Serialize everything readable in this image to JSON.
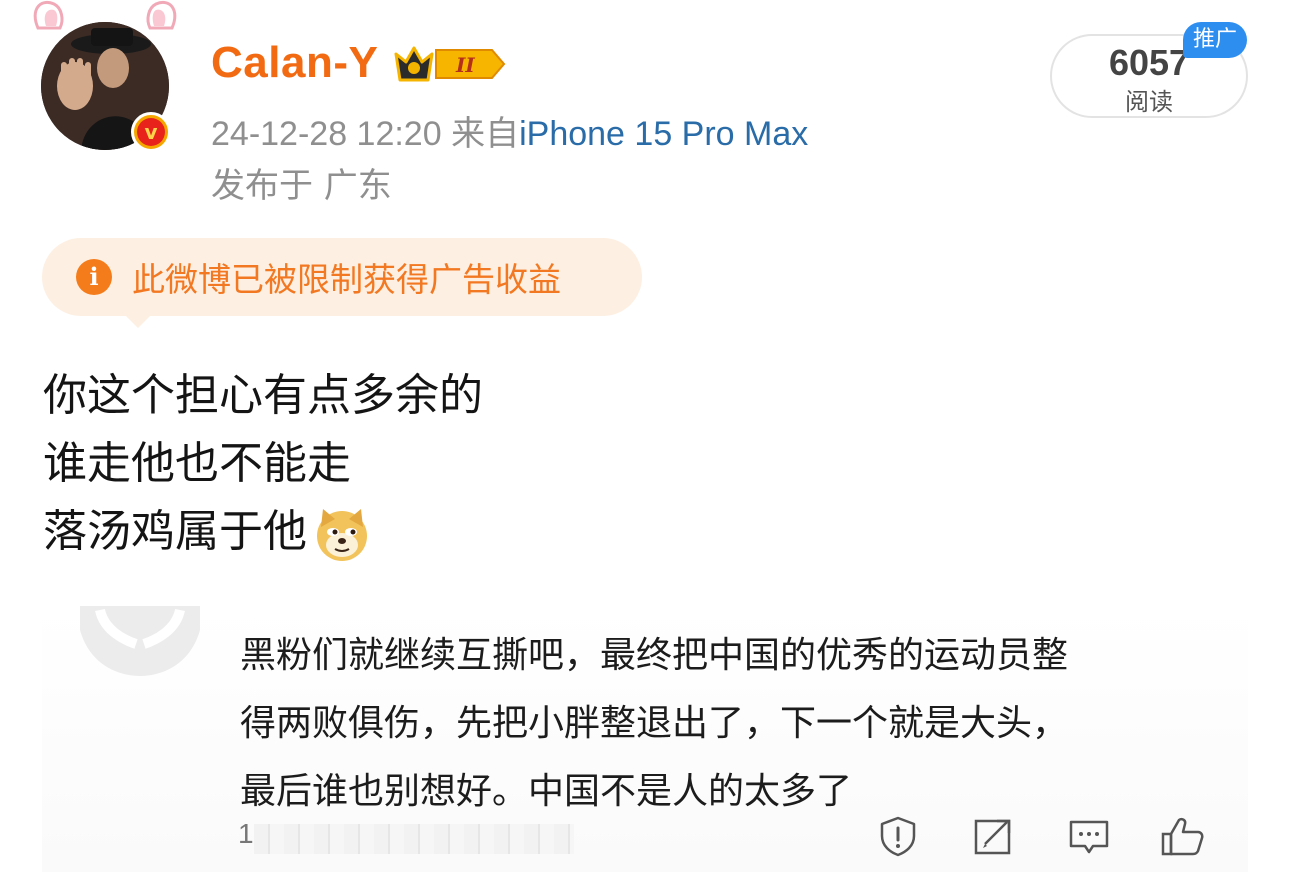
{
  "post": {
    "username": "Calan-Y",
    "member_level": "II",
    "timestamp": "24-12-28 12:20",
    "source_prefix": "来自",
    "device": "iPhone 15 Pro Max",
    "location": "发布于 广东",
    "read_count": "6057",
    "read_label": "阅读",
    "promo_tag": "推广",
    "ad_notice": "此微博已被限制获得广告收益",
    "body_lines": [
      "你这个担心有点多余的",
      "谁走他也不能走",
      "落汤鸡属于他"
    ],
    "emoji": "doge-emoji"
  },
  "quoted_comment": {
    "lines": [
      "黑粉们就继续互撕吧，最终把中国的优秀的运动员整",
      "得两败俱伤，先把小胖整退出了，下一个就是大头，",
      "最后谁也别想好。中国不是人的太多了"
    ],
    "footer_number": "1"
  },
  "actions": [
    "report-icon",
    "repost-icon",
    "comment-icon",
    "like-icon"
  ],
  "colors": {
    "username": "#f26b13",
    "device_link": "#2a6ca8",
    "notice_bg": "#fdefe2",
    "notice_text": "#f27821",
    "promo_tag": "#2e8ef0",
    "verified_badge": "#f5a700"
  }
}
